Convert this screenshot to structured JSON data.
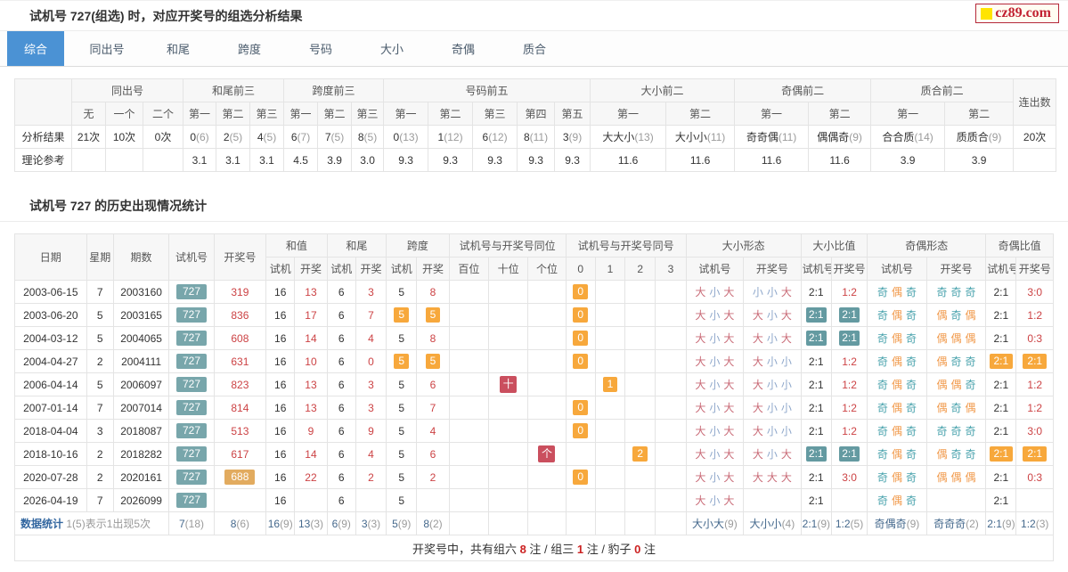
{
  "logo": {
    "text": "cz89.com"
  },
  "page_title": "试机号 727(组选) 时，对应开奖号的组选分析结果",
  "tabs": [
    {
      "label": "综合",
      "active": true
    },
    {
      "label": "同出号",
      "active": false
    },
    {
      "label": "和尾",
      "active": false
    },
    {
      "label": "跨度",
      "active": false
    },
    {
      "label": "号码",
      "active": false
    },
    {
      "label": "大小",
      "active": false
    },
    {
      "label": "奇偶",
      "active": false
    },
    {
      "label": "质合",
      "active": false
    }
  ],
  "analysis": {
    "groups": [
      {
        "label": "同出号",
        "span": 3
      },
      {
        "label": "和尾前三",
        "span": 3
      },
      {
        "label": "跨度前三",
        "span": 3
      },
      {
        "label": "号码前五",
        "span": 5
      },
      {
        "label": "大小前二",
        "span": 2
      },
      {
        "label": "奇偶前二",
        "span": 2
      },
      {
        "label": "质合前二",
        "span": 2
      }
    ],
    "lianchu_label": "连出数",
    "subheads": [
      "无",
      "一个",
      "二个",
      "第一",
      "第二",
      "第三",
      "第一",
      "第二",
      "第三",
      "第一",
      "第二",
      "第三",
      "第四",
      "第五",
      "第一",
      "第二",
      "第一",
      "第二",
      "第一",
      "第二"
    ],
    "rows": [
      {
        "label": "分析结果",
        "cells": [
          "21次",
          "10次",
          "0次",
          "0(6)",
          "2(5)",
          "4(5)",
          "6(7)",
          "7(5)",
          "8(5)",
          "0(13)",
          "1(12)",
          "6(12)",
          "8(11)",
          "3(9)",
          "大大小(13)",
          "大小小(11)",
          "奇奇偶(11)",
          "偶偶奇(9)",
          "合合质(14)",
          "质质合(9)"
        ],
        "lianchu": "20次"
      },
      {
        "label": "理论参考",
        "cells": [
          "",
          "",
          "",
          "3.1",
          "3.1",
          "3.1",
          "4.5",
          "3.9",
          "3.0",
          "9.3",
          "9.3",
          "9.3",
          "9.3",
          "9.3",
          "11.6",
          "11.6",
          "11.6",
          "11.6",
          "3.9",
          "3.9"
        ],
        "lianchu": ""
      }
    ]
  },
  "history": {
    "title": "试机号 727 的历史出现情况统计",
    "head_fixed": [
      "日期",
      "星期",
      "期数",
      "试机号",
      "开奖号"
    ],
    "head_groups": [
      {
        "label": "和值",
        "cols": [
          "试机",
          "开奖"
        ]
      },
      {
        "label": "和尾",
        "cols": [
          "试机",
          "开奖"
        ]
      },
      {
        "label": "跨度",
        "cols": [
          "试机",
          "开奖"
        ]
      },
      {
        "label": "试机号与开奖号同位",
        "cols": [
          "百位",
          "十位",
          "个位"
        ]
      },
      {
        "label": "试机号与开奖号同号",
        "cols": [
          "0",
          "1",
          "2",
          "3"
        ]
      },
      {
        "label": "大小形态",
        "cols": [
          "试机号",
          "开奖号"
        ]
      },
      {
        "label": "大小比值",
        "cols": [
          "试机号",
          "开奖号"
        ]
      },
      {
        "label": "奇偶形态",
        "cols": [
          "试机号",
          "开奖号"
        ]
      },
      {
        "label": "奇偶比值",
        "cols": [
          "试机号",
          "开奖号"
        ]
      }
    ],
    "rows": [
      [
        "2003-06-15",
        "7",
        "2003160",
        {
          "v": "727",
          "s": "sj"
        },
        {
          "v": "319",
          "s": "r"
        },
        "16",
        {
          "v": "13",
          "s": "r"
        },
        "6",
        {
          "v": "3",
          "s": "r"
        },
        "5",
        {
          "v": "8",
          "s": "r"
        },
        "",
        "",
        "",
        {
          "v": "0",
          "s": "ob"
        },
        "",
        "",
        "",
        {
          "v": "大小大",
          "s": "p"
        },
        {
          "v": "小小大",
          "s": "p"
        },
        "2:1",
        {
          "v": "1:2",
          "s": "r"
        },
        {
          "v": "奇偶奇",
          "s": "p"
        },
        {
          "v": "奇奇奇",
          "s": "p"
        },
        "2:1",
        {
          "v": "3:0",
          "s": "r"
        }
      ],
      [
        "2003-06-20",
        "5",
        "2003165",
        {
          "v": "727",
          "s": "sj"
        },
        {
          "v": "836",
          "s": "r"
        },
        "16",
        {
          "v": "17",
          "s": "r"
        },
        "6",
        {
          "v": "7",
          "s": "r"
        },
        {
          "v": "5",
          "s": "ob"
        },
        {
          "v": "5",
          "s": "ob"
        },
        "",
        "",
        "",
        {
          "v": "0",
          "s": "ob"
        },
        "",
        "",
        "",
        {
          "v": "大小大",
          "s": "p"
        },
        {
          "v": "大小大",
          "s": "p"
        },
        {
          "v": "2:1",
          "s": "tb"
        },
        {
          "v": "2:1",
          "s": "tb"
        },
        {
          "v": "奇偶奇",
          "s": "p"
        },
        {
          "v": "偶奇偶",
          "s": "p"
        },
        "2:1",
        {
          "v": "1:2",
          "s": "r"
        }
      ],
      [
        "2004-03-12",
        "5",
        "2004065",
        {
          "v": "727",
          "s": "sj"
        },
        {
          "v": "608",
          "s": "r"
        },
        "16",
        {
          "v": "14",
          "s": "r"
        },
        "6",
        {
          "v": "4",
          "s": "r"
        },
        "5",
        {
          "v": "8",
          "s": "r"
        },
        "",
        "",
        "",
        {
          "v": "0",
          "s": "ob"
        },
        "",
        "",
        "",
        {
          "v": "大小大",
          "s": "p"
        },
        {
          "v": "大小大",
          "s": "p"
        },
        {
          "v": "2:1",
          "s": "tb"
        },
        {
          "v": "2:1",
          "s": "tb"
        },
        {
          "v": "奇偶奇",
          "s": "p"
        },
        {
          "v": "偶偶偶",
          "s": "p"
        },
        "2:1",
        {
          "v": "0:3",
          "s": "r"
        }
      ],
      [
        "2004-04-27",
        "2",
        "2004111",
        {
          "v": "727",
          "s": "sj"
        },
        {
          "v": "631",
          "s": "r"
        },
        "16",
        {
          "v": "10",
          "s": "r"
        },
        "6",
        {
          "v": "0",
          "s": "r"
        },
        {
          "v": "5",
          "s": "ob"
        },
        {
          "v": "5",
          "s": "ob"
        },
        "",
        "",
        "",
        {
          "v": "0",
          "s": "ob"
        },
        "",
        "",
        "",
        {
          "v": "大小大",
          "s": "p"
        },
        {
          "v": "大小小",
          "s": "p"
        },
        "2:1",
        {
          "v": "1:2",
          "s": "r"
        },
        {
          "v": "奇偶奇",
          "s": "p"
        },
        {
          "v": "偶奇奇",
          "s": "p"
        },
        {
          "v": "2:1",
          "s": "ob"
        },
        {
          "v": "2:1",
          "s": "ob"
        }
      ],
      [
        "2006-04-14",
        "5",
        "2006097",
        {
          "v": "727",
          "s": "sj"
        },
        {
          "v": "823",
          "s": "r"
        },
        "16",
        {
          "v": "13",
          "s": "r"
        },
        "6",
        {
          "v": "3",
          "s": "r"
        },
        "5",
        {
          "v": "6",
          "s": "r"
        },
        "",
        {
          "v": "十",
          "s": "rb"
        },
        "",
        "",
        {
          "v": "1",
          "s": "ob"
        },
        "",
        "",
        {
          "v": "大小大",
          "s": "p"
        },
        {
          "v": "大小小",
          "s": "p"
        },
        "2:1",
        {
          "v": "1:2",
          "s": "r"
        },
        {
          "v": "奇偶奇",
          "s": "p"
        },
        {
          "v": "偶偶奇",
          "s": "p"
        },
        "2:1",
        {
          "v": "1:2",
          "s": "r"
        }
      ],
      [
        "2007-01-14",
        "7",
        "2007014",
        {
          "v": "727",
          "s": "sj"
        },
        {
          "v": "814",
          "s": "r"
        },
        "16",
        {
          "v": "13",
          "s": "r"
        },
        "6",
        {
          "v": "3",
          "s": "r"
        },
        "5",
        {
          "v": "7",
          "s": "r"
        },
        "",
        "",
        "",
        {
          "v": "0",
          "s": "ob"
        },
        "",
        "",
        "",
        {
          "v": "大小大",
          "s": "p"
        },
        {
          "v": "大小小",
          "s": "p"
        },
        "2:1",
        {
          "v": "1:2",
          "s": "r"
        },
        {
          "v": "奇偶奇",
          "s": "p"
        },
        {
          "v": "偶奇偶",
          "s": "p"
        },
        "2:1",
        {
          "v": "1:2",
          "s": "r"
        }
      ],
      [
        "2018-04-04",
        "3",
        "2018087",
        {
          "v": "727",
          "s": "sj"
        },
        {
          "v": "513",
          "s": "r"
        },
        "16",
        {
          "v": "9",
          "s": "r"
        },
        "6",
        {
          "v": "9",
          "s": "r"
        },
        "5",
        {
          "v": "4",
          "s": "r"
        },
        "",
        "",
        "",
        {
          "v": "0",
          "s": "ob"
        },
        "",
        "",
        "",
        {
          "v": "大小大",
          "s": "p"
        },
        {
          "v": "大小小",
          "s": "p"
        },
        "2:1",
        {
          "v": "1:2",
          "s": "r"
        },
        {
          "v": "奇偶奇",
          "s": "p"
        },
        {
          "v": "奇奇奇",
          "s": "p"
        },
        "2:1",
        {
          "v": "3:0",
          "s": "r"
        }
      ],
      [
        "2018-10-16",
        "2",
        "2018282",
        {
          "v": "727",
          "s": "sj"
        },
        {
          "v": "617",
          "s": "r"
        },
        "16",
        {
          "v": "14",
          "s": "r"
        },
        "6",
        {
          "v": "4",
          "s": "r"
        },
        "5",
        {
          "v": "6",
          "s": "r"
        },
        "",
        "",
        {
          "v": "个",
          "s": "rb"
        },
        "",
        "",
        {
          "v": "2",
          "s": "ob"
        },
        "",
        {
          "v": "大小大",
          "s": "p"
        },
        {
          "v": "大小大",
          "s": "p"
        },
        {
          "v": "2:1",
          "s": "tb"
        },
        {
          "v": "2:1",
          "s": "tb"
        },
        {
          "v": "奇偶奇",
          "s": "p"
        },
        {
          "v": "偶奇奇",
          "s": "p"
        },
        {
          "v": "2:1",
          "s": "ob"
        },
        {
          "v": "2:1",
          "s": "ob"
        }
      ],
      [
        "2020-07-28",
        "2",
        "2020161",
        {
          "v": "727",
          "s": "sj"
        },
        {
          "v": "688",
          "s": "kj"
        },
        "16",
        {
          "v": "22",
          "s": "r"
        },
        "6",
        {
          "v": "2",
          "s": "r"
        },
        "5",
        {
          "v": "2",
          "s": "r"
        },
        "",
        "",
        "",
        {
          "v": "0",
          "s": "ob"
        },
        "",
        "",
        "",
        {
          "v": "大小大",
          "s": "p"
        },
        {
          "v": "大大大",
          "s": "p"
        },
        "2:1",
        {
          "v": "3:0",
          "s": "r"
        },
        {
          "v": "奇偶奇",
          "s": "p"
        },
        {
          "v": "偶偶偶",
          "s": "p"
        },
        "2:1",
        {
          "v": "0:3",
          "s": "r"
        }
      ],
      [
        "2026-04-19",
        "7",
        "2026099",
        {
          "v": "727",
          "s": "sj"
        },
        "",
        "16",
        "",
        "6",
        "",
        "5",
        "",
        "",
        "",
        "",
        "",
        "",
        "",
        "",
        {
          "v": "大小大",
          "s": "p"
        },
        "",
        "2:1",
        "",
        {
          "v": "奇偶奇",
          "s": "p"
        },
        "",
        "2:1",
        ""
      ]
    ],
    "stats": {
      "label": "数据统计",
      "note": "1(5)表示1出现5次",
      "cells": [
        {
          "v": "7(18)",
          "s": "st"
        },
        {
          "v": "8(6)",
          "s": "st"
        },
        {
          "v": "16(9)",
          "s": "st"
        },
        {
          "v": "13(3)",
          "s": "st"
        },
        {
          "v": "6(9)",
          "s": "st"
        },
        {
          "v": "3(3)",
          "s": "st"
        },
        {
          "v": "5(9)",
          "s": "st"
        },
        {
          "v": "8(2)",
          "s": "st"
        },
        "",
        "",
        "",
        "",
        "",
        "",
        "",
        {
          "v": "大小大(9)",
          "s": "st"
        },
        {
          "v": "大小小(4)",
          "s": "st"
        },
        {
          "v": "2:1(9)",
          "s": "st"
        },
        {
          "v": "1:2(5)",
          "s": "st"
        },
        {
          "v": "奇偶奇(9)",
          "s": "st"
        },
        {
          "v": "奇奇奇(2)",
          "s": "st"
        },
        {
          "v": "2:1(9)",
          "s": "st"
        },
        {
          "v": "1:2(3)",
          "s": "st"
        }
      ]
    },
    "footer": {
      "prefix": "开奖号中，共有组六 ",
      "n1": "8",
      "mid1": " 注 / 组三 ",
      "n2": "1",
      "mid2": " 注 / 豹子 ",
      "n3": "0",
      "suffix": " 注"
    }
  }
}
